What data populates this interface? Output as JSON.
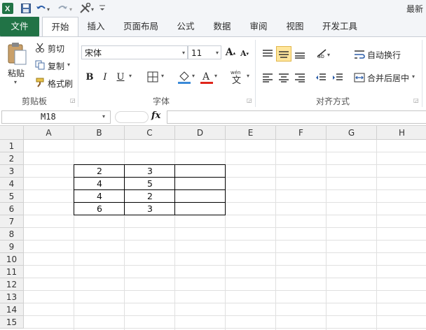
{
  "title_bar": {
    "title": "最新"
  },
  "tabs": [
    {
      "label": "文件"
    },
    {
      "label": "开始"
    },
    {
      "label": "插入"
    },
    {
      "label": "页面布局"
    },
    {
      "label": "公式"
    },
    {
      "label": "数据"
    },
    {
      "label": "审阅"
    },
    {
      "label": "视图"
    },
    {
      "label": "开发工具"
    }
  ],
  "clipboard": {
    "paste": "粘贴",
    "cut": "剪切",
    "copy": "复制",
    "format_painter": "格式刷",
    "group_label": "剪贴板"
  },
  "font": {
    "font_name": "宋体",
    "font_size": "11",
    "bold": "B",
    "italic": "I",
    "underline": "U",
    "group_label": "字体"
  },
  "alignment": {
    "wrap_text": "自动换行",
    "merge_center": "合并后居中",
    "group_label": "对齐方式"
  },
  "formula_bar": {
    "name_box": "M18",
    "fx": "fx",
    "formula": ""
  },
  "columns": [
    "A",
    "B",
    "C",
    "D",
    "E",
    "F",
    "G",
    "H"
  ],
  "rows": [
    "1",
    "2",
    "3",
    "4",
    "5",
    "6",
    "7",
    "8",
    "9",
    "10",
    "11",
    "12",
    "13",
    "14",
    "15"
  ],
  "table": {
    "B3": "2",
    "C3": "3",
    "B4": "4",
    "C4": "5",
    "B5": "4",
    "C5": "2",
    "B6": "6",
    "C6": "3"
  },
  "colors": {
    "file_tab": "#217346",
    "highlight_yellow": "#ffe69c",
    "font_red": "#e0261b",
    "fill_blue": "#3b8ad8"
  }
}
